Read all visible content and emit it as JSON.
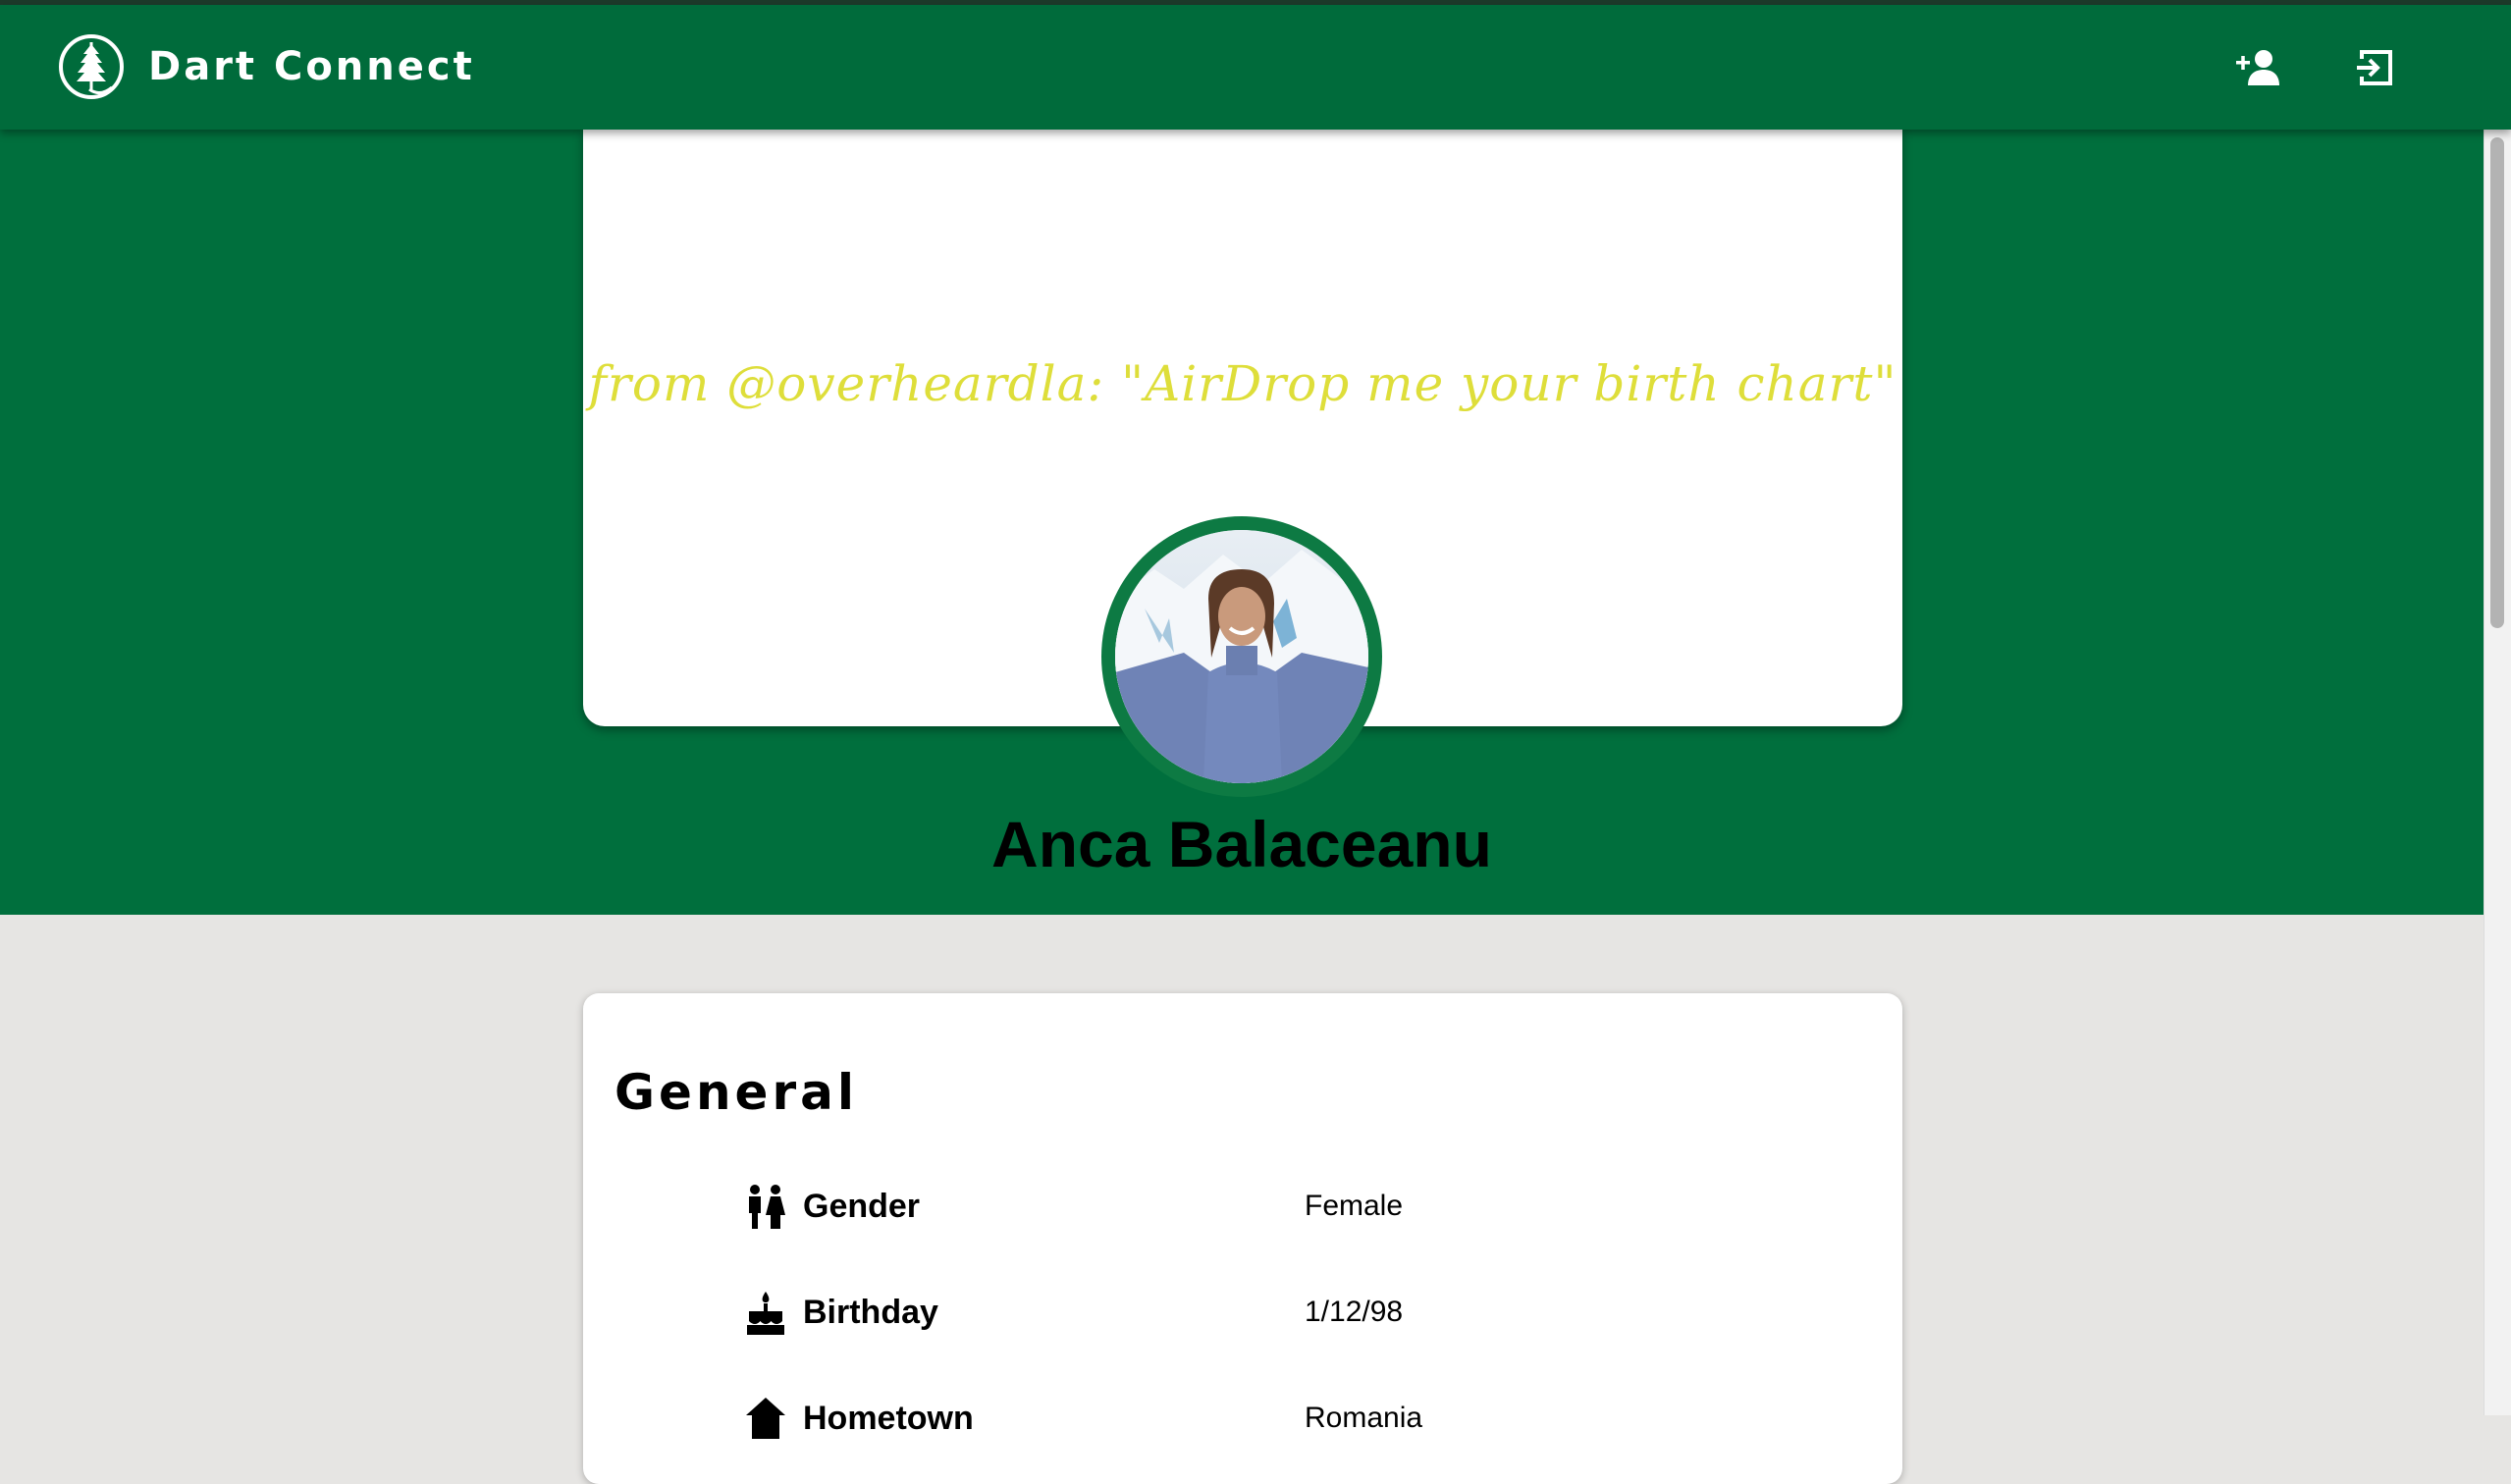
{
  "app": {
    "title": "Dart Connect"
  },
  "nav": {
    "add_friend_icon": "person-add-icon",
    "logout_icon": "logout-icon"
  },
  "profile": {
    "cover_quote": "from @overheardla: \"AirDrop me your birth chart\"",
    "name": "Anca Balaceanu"
  },
  "general": {
    "title": "General",
    "rows": [
      {
        "icon": "wc-icon",
        "label": "Gender",
        "value": "Female"
      },
      {
        "icon": "cake-icon",
        "label": "Birthday",
        "value": "1/12/98"
      },
      {
        "icon": "home-icon",
        "label": "Hometown",
        "value": "Romania"
      }
    ]
  },
  "colors": {
    "brand_green": "#006b3b",
    "hero_green": "#006f3d",
    "quote_yellow": "#dede3a",
    "page_bg": "#e6e5e3"
  }
}
